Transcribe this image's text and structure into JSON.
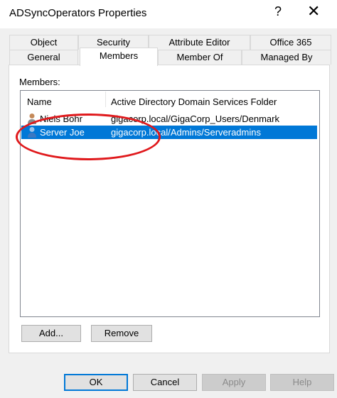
{
  "window": {
    "title": "ADSyncOperators Properties",
    "help_glyph": "?",
    "close_glyph": "✕"
  },
  "tabs": {
    "row1": [
      {
        "label": "Object"
      },
      {
        "label": "Security"
      },
      {
        "label": "Attribute Editor"
      },
      {
        "label": "Office 365"
      }
    ],
    "row2": [
      {
        "label": "General"
      },
      {
        "label": "Members",
        "active": true
      },
      {
        "label": "Member Of"
      },
      {
        "label": "Managed By"
      }
    ]
  },
  "members": {
    "label": "Members:",
    "columns": [
      "Name",
      "Active Directory Domain Services Folder"
    ],
    "rows": [
      {
        "name": "Niels Bohr",
        "folder": "gigacorp.local/GigaCorp_Users/Denmark",
        "icon": "user-icon",
        "selected": false
      },
      {
        "name": "Server Joe",
        "folder": "gigacorp.local/Admins/Serveradmins",
        "icon": "user-icon",
        "selected": true
      }
    ],
    "add_label": "Add...",
    "remove_label": "Remove"
  },
  "footer": {
    "ok_label": "OK",
    "cancel_label": "Cancel",
    "apply_label": "Apply",
    "help_label": "Help"
  },
  "colors": {
    "selection": "#0078d7",
    "annotation": "#e0191c"
  }
}
